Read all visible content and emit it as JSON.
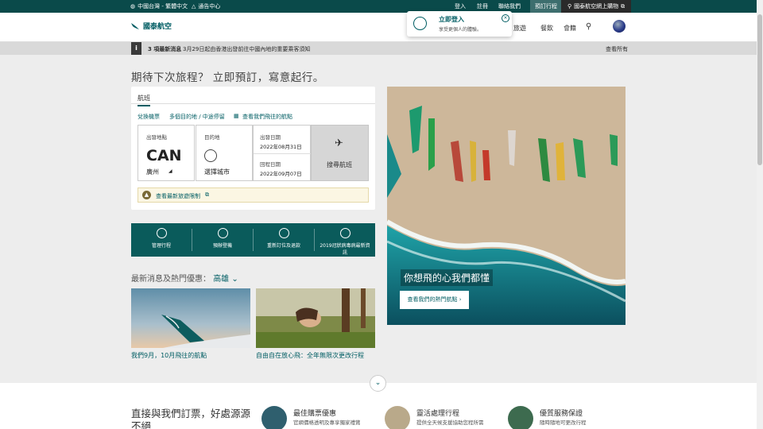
{
  "topbar": {
    "region": "中國台灣 - 繁體中文",
    "notifications": "通告中心",
    "login": "登入",
    "register": "註冊",
    "contact": "聯絡我們",
    "manage": "預訂行程",
    "shop": "國泰航空網上購物"
  },
  "header": {
    "brand": "國泰航空",
    "nav": [
      "旅遊",
      "餐飲",
      "會籍"
    ]
  },
  "login_popup": {
    "title": "立即登入",
    "subtitle": "享受更個人的體驗。"
  },
  "alert": {
    "count_label": "3 項最新消息",
    "message": "3月29日起由香港出發前往中國內地的重要乘客須知",
    "view_all": "查看所有"
  },
  "heading": "期待下次旅程？ 立即預訂，寫意起行。",
  "booking": {
    "tab": "航班",
    "links": [
      "兌換機票",
      "多個目的地 / 中途停留",
      "查看我們飛往的航點"
    ],
    "origin_label": "出發地點",
    "origin_code": "CAN",
    "origin_city": "廣州",
    "dest_label": "目的地",
    "dest_value": "選擇城市",
    "depart_label": "出發日期",
    "depart_date": "2022年08月31日",
    "return_label": "回程日期",
    "return_date": "2022年09月07日",
    "search_label": "搜尋航班",
    "notice": "查看最新旅遊限制"
  },
  "quick_links": [
    "管理行程",
    "預辦登機",
    "重新訂位及退款",
    "2019冠狀病毒病最新資訊"
  ],
  "offers": {
    "title": "最新消息及熱門優惠：",
    "city": "高雄",
    "items": [
      {
        "caption": "我們9月，10月飛往的航點"
      },
      {
        "caption": "自由自在放心飛：全年無限次更改行程"
      }
    ]
  },
  "hero": {
    "caption": "你想飛的心我們都懂",
    "button": "查看我們的熱門航點"
  },
  "bottom": {
    "title": "直接與我們訂票，好處源源不絕",
    "features": [
      {
        "title": "最佳購票優惠",
        "desc": "官網價格透明及專享獨家禮賞",
        "color": "#2f5f6e"
      },
      {
        "title": "靈活處理行程",
        "desc": "提供全天候支援協助您程所需",
        "color": "#b9a98a"
      },
      {
        "title": "優質服務保證",
        "desc": "隨時隨地可更改行程",
        "color": "#3d6b4f"
      }
    ]
  },
  "colors": {
    "brand": "#005d63",
    "topbar": "#0a4a4a",
    "quickbar": "#0a5b5b"
  }
}
